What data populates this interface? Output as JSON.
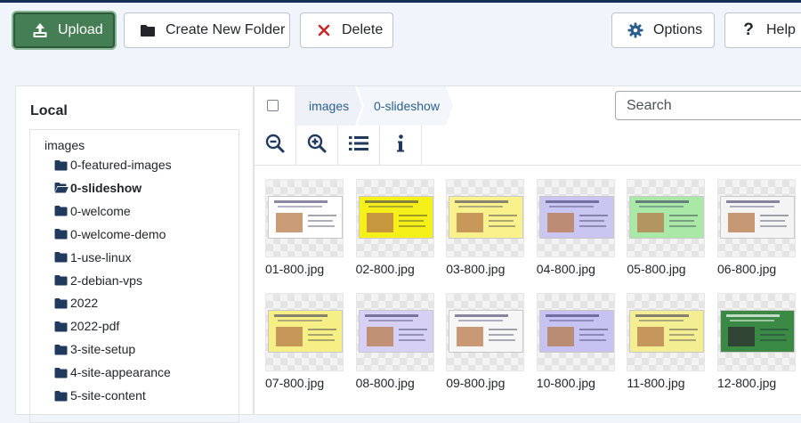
{
  "toolbar": {
    "upload_label": "Upload",
    "new_folder_label": "Create New Folder",
    "delete_label": "Delete",
    "options_label": "Options",
    "help_label": "Help"
  },
  "sidebar": {
    "title": "Local",
    "root": "images",
    "items": [
      {
        "label": "0-featured-images",
        "active": false
      },
      {
        "label": "0-slideshow",
        "active": true
      },
      {
        "label": "0-welcome",
        "active": false
      },
      {
        "label": "0-welcome-demo",
        "active": false
      },
      {
        "label": "1-use-linux",
        "active": false
      },
      {
        "label": "2-debian-vps",
        "active": false
      },
      {
        "label": "2022",
        "active": false
      },
      {
        "label": "2022-pdf",
        "active": false
      },
      {
        "label": "3-site-setup",
        "active": false
      },
      {
        "label": "4-site-appearance",
        "active": false
      },
      {
        "label": "5-site-content",
        "active": false
      }
    ]
  },
  "breadcrumb": [
    "images",
    "0-slideshow"
  ],
  "search": {
    "placeholder": "Search"
  },
  "files": [
    {
      "name": "01-800.jpg",
      "bg": "#ffffff"
    },
    {
      "name": "02-800.jpg",
      "bg": "#f5ef1a"
    },
    {
      "name": "03-800.jpg",
      "bg": "#f9f18c"
    },
    {
      "name": "04-800.jpg",
      "bg": "#c9c6f2"
    },
    {
      "name": "05-800.jpg",
      "bg": "#a9e8a6"
    },
    {
      "name": "06-800.jpg",
      "bg": "#f4f4f4"
    },
    {
      "name": "07-800.jpg",
      "bg": "#f6ef86"
    },
    {
      "name": "08-800.jpg",
      "bg": "#d6d1f4"
    },
    {
      "name": "09-800.jpg",
      "bg": "#f6f6f6"
    },
    {
      "name": "10-800.jpg",
      "bg": "#c6c3f3"
    },
    {
      "name": "11-800.jpg",
      "bg": "#f4ee92"
    },
    {
      "name": "12-800.jpg",
      "bg": "#3a8a45"
    }
  ],
  "colors": {
    "accent": "#457d54",
    "link": "#2a5e8c",
    "delete": "#c52827",
    "options": "#2a5e8c",
    "folder": "#1f3a5c"
  },
  "icons": {
    "upload": "upload-icon",
    "folder": "folder-icon",
    "delete": "x-icon",
    "options": "gear-icon",
    "help": "question-icon",
    "zoom_out": "zoom-out-icon",
    "zoom_in": "zoom-in-icon",
    "list": "list-view-icon",
    "info": "info-icon"
  }
}
